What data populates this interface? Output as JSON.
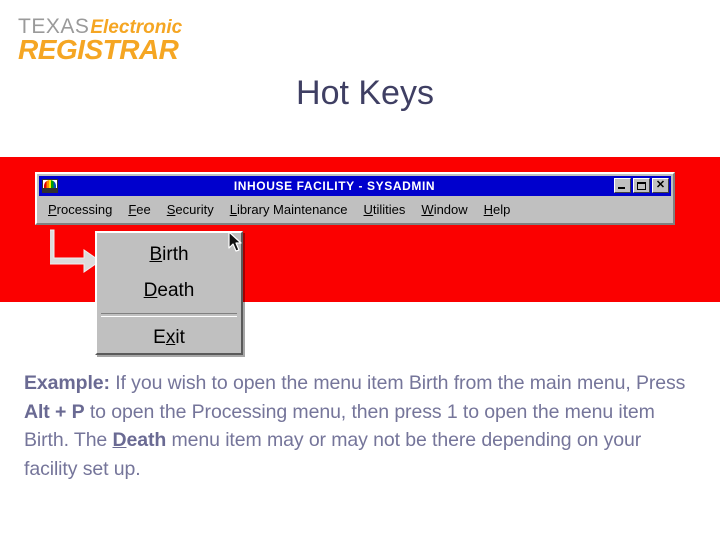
{
  "logo": {
    "texas": "TEXAS",
    "electronic": "Electronic",
    "registrar": "REGISTRAR",
    "gray": "#9a9a9a",
    "orange": "#f5a623"
  },
  "slide": {
    "title": "Hot Keys",
    "title_color": "#3f3f63",
    "band_color": "#fb0000"
  },
  "window": {
    "icon_name": "app-logo-icon",
    "title": "INHOUSE FACILITY - SYSADMIN",
    "titlebar_color": "#0000cd",
    "buttons": {
      "minimize": "_",
      "maximize": "□",
      "close": "✕"
    },
    "menubar": [
      {
        "label_pre": "",
        "accel": "P",
        "label_post": "rocessing",
        "name": "menu-processing"
      },
      {
        "label_pre": "",
        "accel": "F",
        "label_post": "ee",
        "name": "menu-fee"
      },
      {
        "label_pre": "",
        "accel": "S",
        "label_post": "ecurity",
        "name": "menu-security"
      },
      {
        "label_pre": "",
        "accel": "L",
        "label_post": "ibrary Maintenance",
        "name": "menu-library-maintenance"
      },
      {
        "label_pre": "",
        "accel": "U",
        "label_post": "tilities",
        "name": "menu-utilities"
      },
      {
        "label_pre": "",
        "accel": "W",
        "label_post": "indow",
        "name": "menu-window"
      },
      {
        "label_pre": "",
        "accel": "H",
        "label_post": "elp",
        "name": "menu-help"
      }
    ]
  },
  "dropdown": {
    "items": [
      {
        "accel": "B",
        "rest": "irth",
        "name": "dropdown-item-birth"
      },
      {
        "accel": "D",
        "rest": "eath",
        "name": "dropdown-item-death"
      },
      {
        "accel": "E",
        "rest": "xit",
        "name": "dropdown-item-exit",
        "accel_index": 1
      }
    ],
    "exit_pre": "E",
    "exit_accel": "x",
    "exit_post": "it"
  },
  "body": {
    "label": "Example:",
    "s1": "  If you wish to open the menu item Birth from the main menu, Press ",
    "b1": "Alt + P",
    "s2": " to open the Processing menu, then press 1 to open the menu item Birth.  The ",
    "b2_accel": "D",
    "b2_rest": "eath",
    "s3": " menu item may or may not be there depending on your facility set up.",
    "text_color": "#75759a"
  }
}
